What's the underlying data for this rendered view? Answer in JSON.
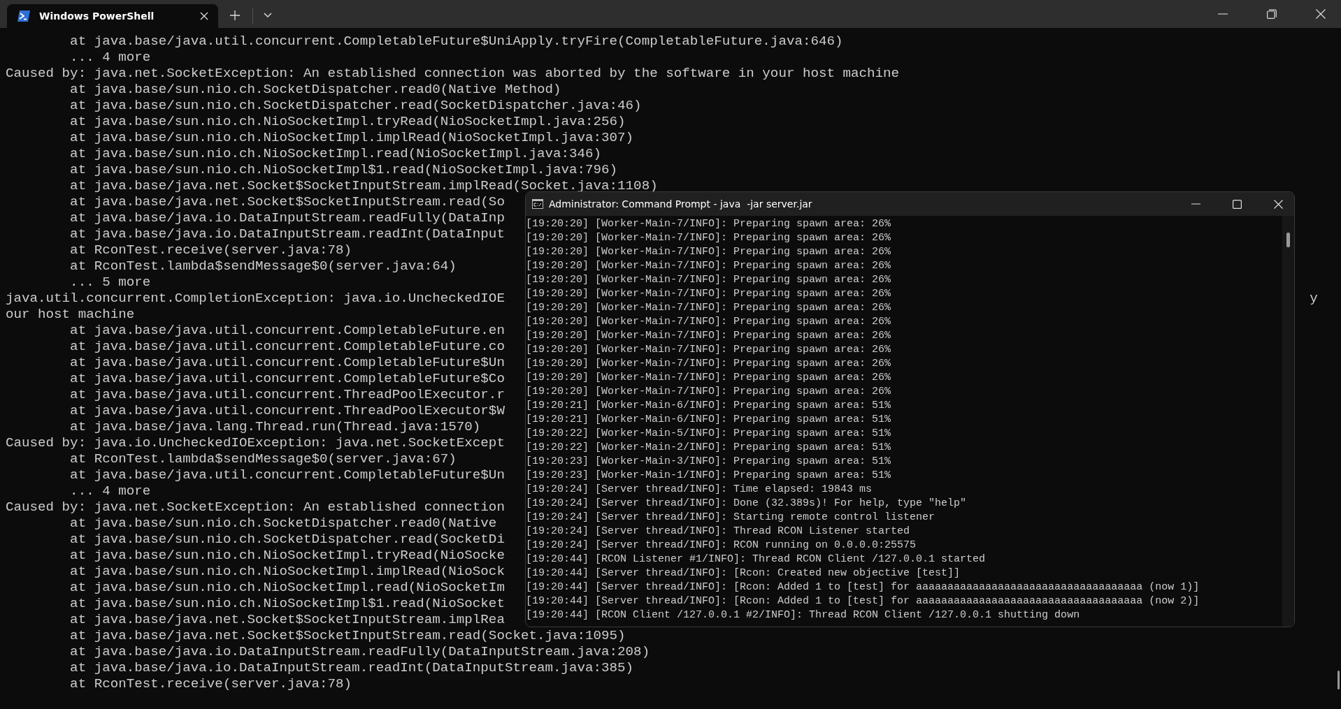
{
  "terminal": {
    "tab": {
      "title": "Windows PowerShell",
      "selected": true
    },
    "lines": [
      {
        "text": "        at java.base/java.util.concurrent.CompletableFuture$UniApply.tryFire(CompletableFuture.java:646)"
      },
      {
        "text": "        ... 4 more"
      },
      {
        "text": "Caused by: java.net.SocketException: An established connection was aborted by the software in your host machine"
      },
      {
        "text": "        at java.base/sun.nio.ch.SocketDispatcher.read0(Native Method)"
      },
      {
        "text": "        at java.base/sun.nio.ch.SocketDispatcher.read(SocketDispatcher.java:46)"
      },
      {
        "text": "        at java.base/sun.nio.ch.NioSocketImpl.tryRead(NioSocketImpl.java:256)"
      },
      {
        "text": "        at java.base/sun.nio.ch.NioSocketImpl.implRead(NioSocketImpl.java:307)"
      },
      {
        "text": "        at java.base/sun.nio.ch.NioSocketImpl.read(NioSocketImpl.java:346)"
      },
      {
        "text": "        at java.base/sun.nio.ch.NioSocketImpl$1.read(NioSocketImpl.java:796)"
      },
      {
        "text": "        at java.base/java.net.Socket$SocketInputStream.implRead(Socket.java:1108)"
      },
      {
        "text": "        at java.base/java.net.Socket$SocketInputStream.read(So"
      },
      {
        "text": "        at java.base/java.io.DataInputStream.readFully(DataInp"
      },
      {
        "text": "        at java.base/java.io.DataInputStream.readInt(DataInput"
      },
      {
        "text": "        at RconTest.receive(server.java:78)"
      },
      {
        "text": "        at RconTest.lambda$sendMessage$0(server.java:64)"
      },
      {
        "text": "        ... 5 more"
      },
      {
        "text": "java.util.concurrent.CompletionException: java.io.UncheckedIOE",
        "tail": "y"
      },
      {
        "text": "our host machine"
      },
      {
        "text": "        at java.base/java.util.concurrent.CompletableFuture.en"
      },
      {
        "text": "        at java.base/java.util.concurrent.CompletableFuture.co"
      },
      {
        "text": "        at java.base/java.util.concurrent.CompletableFuture$Un"
      },
      {
        "text": "        at java.base/java.util.concurrent.CompletableFuture$Co"
      },
      {
        "text": "        at java.base/java.util.concurrent.ThreadPoolExecutor.r"
      },
      {
        "text": "        at java.base/java.util.concurrent.ThreadPoolExecutor$W"
      },
      {
        "text": "        at java.base/java.lang.Thread.run(Thread.java:1570)"
      },
      {
        "text": "Caused by: java.io.UncheckedIOException: java.net.SocketExcept"
      },
      {
        "text": "        at RconTest.lambda$sendMessage$0(server.java:67)"
      },
      {
        "text": "        at java.base/java.util.concurrent.CompletableFuture$Un"
      },
      {
        "text": "        ... 4 more"
      },
      {
        "text": "Caused by: java.net.SocketException: An established connection"
      },
      {
        "text": "        at java.base/sun.nio.ch.SocketDispatcher.read0(Native"
      },
      {
        "text": "        at java.base/sun.nio.ch.SocketDispatcher.read(SocketDi"
      },
      {
        "text": "        at java.base/sun.nio.ch.NioSocketImpl.tryRead(NioSocke"
      },
      {
        "text": "        at java.base/sun.nio.ch.NioSocketImpl.implRead(NioSock"
      },
      {
        "text": "        at java.base/sun.nio.ch.NioSocketImpl.read(NioSocketIm"
      },
      {
        "text": "        at java.base/sun.nio.ch.NioSocketImpl$1.read(NioSocket"
      },
      {
        "text": "        at java.base/java.net.Socket$SocketInputStream.implRea"
      },
      {
        "text": "        at java.base/java.net.Socket$SocketInputStream.read(Socket.java:1095)"
      },
      {
        "text": "        at java.base/java.io.DataInputStream.readFully(DataInputStream.java:208)"
      },
      {
        "text": "        at java.base/java.io.DataInputStream.readInt(DataInputStream.java:385)"
      },
      {
        "text": "        at RconTest.receive(server.java:78)"
      }
    ]
  },
  "cmd_window": {
    "title": "Administrator: Command Prompt - java  -jar server.jar",
    "lines": [
      "[19:20:20] [Worker-Main-7/INFO]: Preparing spawn area: 26%",
      "[19:20:20] [Worker-Main-7/INFO]: Preparing spawn area: 26%",
      "[19:20:20] [Worker-Main-7/INFO]: Preparing spawn area: 26%",
      "[19:20:20] [Worker-Main-7/INFO]: Preparing spawn area: 26%",
      "[19:20:20] [Worker-Main-7/INFO]: Preparing spawn area: 26%",
      "[19:20:20] [Worker-Main-7/INFO]: Preparing spawn area: 26%",
      "[19:20:20] [Worker-Main-7/INFO]: Preparing spawn area: 26%",
      "[19:20:20] [Worker-Main-7/INFO]: Preparing spawn area: 26%",
      "[19:20:20] [Worker-Main-7/INFO]: Preparing spawn area: 26%",
      "[19:20:20] [Worker-Main-7/INFO]: Preparing spawn area: 26%",
      "[19:20:20] [Worker-Main-7/INFO]: Preparing spawn area: 26%",
      "[19:20:20] [Worker-Main-7/INFO]: Preparing spawn area: 26%",
      "[19:20:20] [Worker-Main-7/INFO]: Preparing spawn area: 26%",
      "[19:20:21] [Worker-Main-6/INFO]: Preparing spawn area: 51%",
      "[19:20:21] [Worker-Main-6/INFO]: Preparing spawn area: 51%",
      "[19:20:22] [Worker-Main-5/INFO]: Preparing spawn area: 51%",
      "[19:20:22] [Worker-Main-2/INFO]: Preparing spawn area: 51%",
      "[19:20:23] [Worker-Main-3/INFO]: Preparing spawn area: 51%",
      "[19:20:23] [Worker-Main-1/INFO]: Preparing spawn area: 51%",
      "[19:20:24] [Server thread/INFO]: Time elapsed: 19843 ms",
      "[19:20:24] [Server thread/INFO]: Done (32.389s)! For help, type \"help\"",
      "[19:20:24] [Server thread/INFO]: Starting remote control listener",
      "[19:20:24] [Server thread/INFO]: Thread RCON Listener started",
      "[19:20:24] [Server thread/INFO]: RCON running on 0.0.0.0:25575",
      "[19:20:44] [RCON Listener #1/INFO]: Thread RCON Client /127.0.0.1 started",
      "[19:20:44] [Server thread/INFO]: [Rcon: Created new objective [test]]",
      "[19:20:44] [Server thread/INFO]: [Rcon: Added 1 to [test] for aaaaaaaaaaaaaaaaaaaaaaaaaaaaaaaaaaaa (now 1)]",
      "[19:20:44] [Server thread/INFO]: [Rcon: Added 1 to [test] for aaaaaaaaaaaaaaaaaaaaaaaaaaaaaaaaaaaa (now 2)]",
      "[19:20:44] [RCON Client /127.0.0.1 #2/INFO]: Thread RCON Client /127.0.0.1 shutting down"
    ]
  }
}
